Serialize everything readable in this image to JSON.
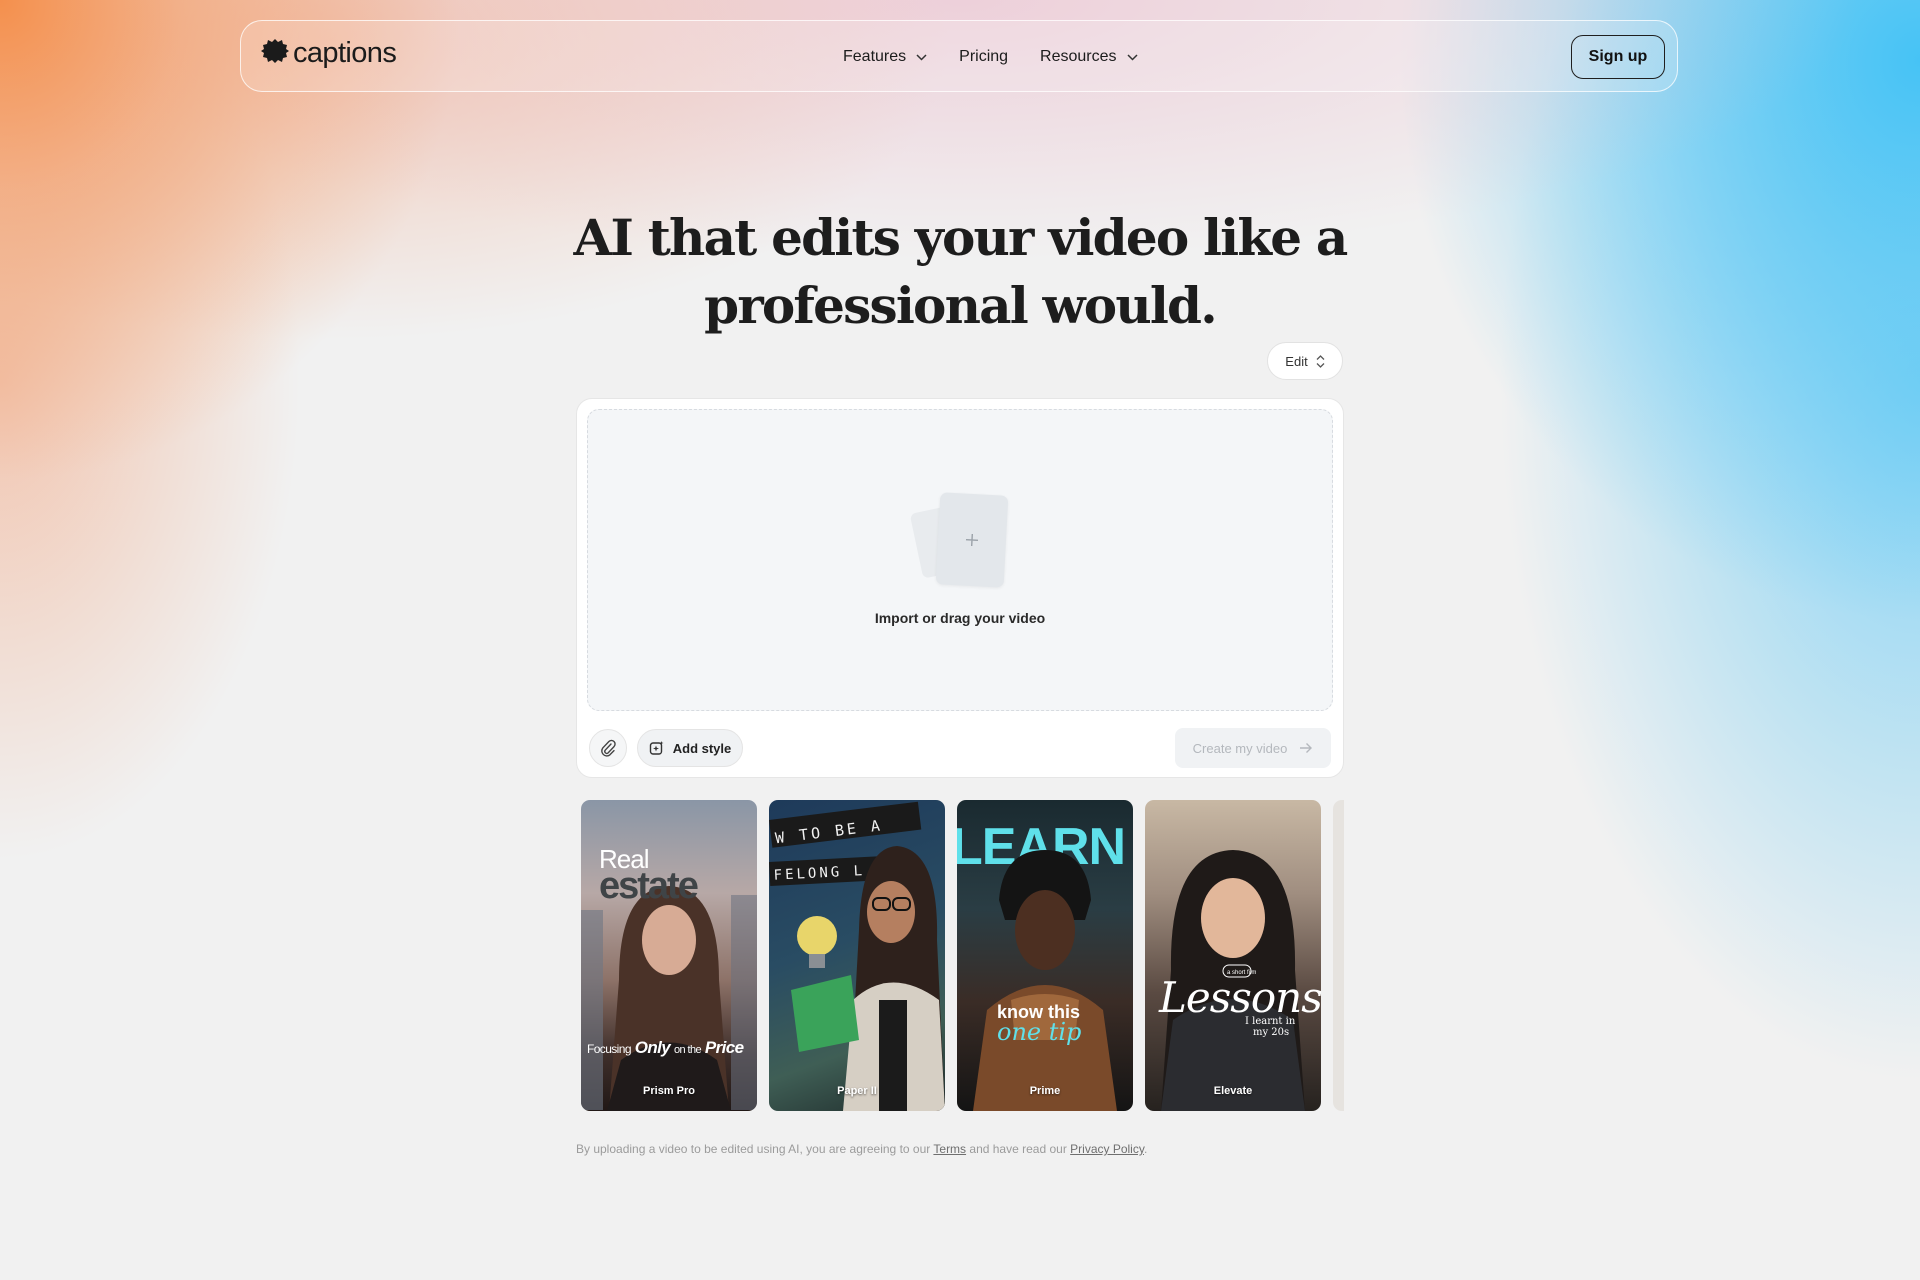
{
  "brand": {
    "name": "captions"
  },
  "nav": {
    "items": [
      {
        "label": "Features",
        "has_dropdown": true
      },
      {
        "label": "Pricing",
        "has_dropdown": false
      },
      {
        "label": "Resources",
        "has_dropdown": true
      }
    ],
    "signup_label": "Sign up"
  },
  "hero": {
    "line1": "AI that edits your video like a",
    "line2": "professional would."
  },
  "mode_select": {
    "value": "Edit"
  },
  "upload": {
    "drop_label": "Import or drag your video",
    "add_style_label": "Add style",
    "create_label": "Create my video"
  },
  "styles": [
    {
      "name": "Prism Pro",
      "overlay_title_1": "Real",
      "overlay_title_2": "estate",
      "overlay_caption_1": "Focusing",
      "overlay_caption_2": "Only",
      "overlay_caption_3": "on the",
      "overlay_caption_4": "Price"
    },
    {
      "name": "Paper II",
      "overlay_text_1": "W TO BE A",
      "overlay_text_2": "FELONG L"
    },
    {
      "name": "Prime",
      "overlay_title": "LEARN",
      "overlay_caption_1": "know this",
      "overlay_caption_2": "one tip"
    },
    {
      "name": "Elevate",
      "overlay_tag": "a short film",
      "overlay_title": "Lessons",
      "overlay_caption_1": "I learnt in",
      "overlay_caption_2": "my 20s"
    }
  ],
  "disclaimer": {
    "text": "By uploading a video to be edited using AI, you are agreeing to our",
    "terms_label": "Terms",
    "middle": "and have read our",
    "privacy_label": "Privacy Policy",
    "end": "."
  },
  "colors": {
    "text": "#1c1c1c",
    "disabled_text": "#b4b8bd",
    "accent_orange": "#f48c46",
    "accent_blue": "#46c3f5"
  }
}
